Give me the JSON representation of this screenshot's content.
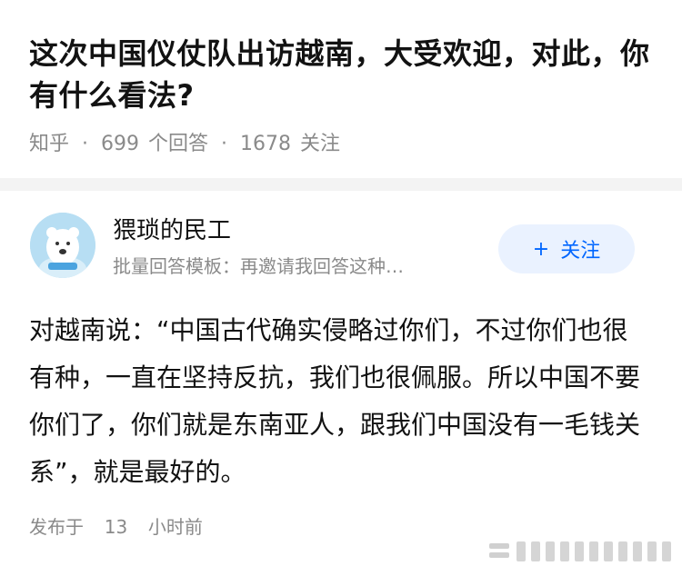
{
  "question": {
    "title": "这次中国仪仗队出访越南，大受欢迎，对此，你有什么看法?",
    "source": "知乎",
    "separator": "·",
    "answers_count": "699",
    "answers_label": "个回答",
    "followers_count": "1678",
    "followers_label": "关注"
  },
  "author": {
    "name": "猥琐的民工",
    "bio": "批量回答模板：再邀请我回答这种…",
    "avatar_icon": "polar-bear-avatar-icon",
    "follow_button": {
      "plus": "+",
      "label": "关注"
    }
  },
  "answer": {
    "text": "对越南说：“中国古代确实侵略过你们，不过你们也很有种，一直在坚持反抗，我们也很佩服。所以中国不要你们了，你们就是东南亚人，跟我们中国没有一毛钱关系”，就是最好的。"
  },
  "footer": {
    "published_label": "发布于",
    "time_value": "13",
    "time_unit": "小时前"
  },
  "colors": {
    "accent": "#0066ff",
    "follow_bg": "#eaf2ff",
    "avatar_bg": "#b7def3",
    "divider": "#f3f3f3"
  }
}
